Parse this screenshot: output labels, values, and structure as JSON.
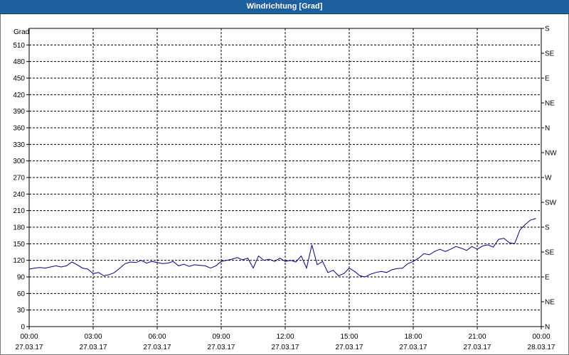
{
  "window": {
    "title": "Windrichtung [Grad]"
  },
  "chart_data": {
    "type": "line",
    "title": "Windrichtung [Grad]",
    "ylabel": "Grad",
    "ylim": [
      0,
      540
    ],
    "yticks": [
      0,
      30,
      60,
      90,
      120,
      150,
      180,
      210,
      240,
      270,
      300,
      330,
      360,
      390,
      420,
      450,
      480,
      510
    ],
    "right_axis_ticks": [
      {
        "value": 0,
        "label": "N"
      },
      {
        "value": 45,
        "label": "NE"
      },
      {
        "value": 90,
        "label": "E"
      },
      {
        "value": 135,
        "label": "SE"
      },
      {
        "value": 180,
        "label": "S"
      },
      {
        "value": 225,
        "label": "SW"
      },
      {
        "value": 270,
        "label": "W"
      },
      {
        "value": 315,
        "label": "NW"
      },
      {
        "value": 360,
        "label": "N"
      },
      {
        "value": 405,
        "label": "NE"
      },
      {
        "value": 450,
        "label": "E"
      },
      {
        "value": 495,
        "label": "SE"
      },
      {
        "value": 540,
        "label": "S"
      }
    ],
    "xlim": [
      "2017-03-27 00:00",
      "2017-03-28 00:00"
    ],
    "xticks": [
      {
        "time": "00:00",
        "date": "27.03.17"
      },
      {
        "time": "03:00",
        "date": "27.03.17"
      },
      {
        "time": "06:00",
        "date": "27.03.17"
      },
      {
        "time": "09:00",
        "date": "27.03.17"
      },
      {
        "time": "12:00",
        "date": "27.03.17"
      },
      {
        "time": "15:00",
        "date": "27.03.17"
      },
      {
        "time": "18:00",
        "date": "27.03.17"
      },
      {
        "time": "21:00",
        "date": "27.03.17"
      },
      {
        "time": "00:00",
        "date": "28.03.17"
      }
    ],
    "grid": true,
    "series": [
      {
        "color": "#00008b",
        "points": [
          [
            "00:00",
            104
          ],
          [
            "00:15",
            106
          ],
          [
            "00:30",
            107
          ],
          [
            "00:45",
            106
          ],
          [
            "01:00",
            108
          ],
          [
            "01:15",
            110
          ],
          [
            "01:30",
            108
          ],
          [
            "01:45",
            110
          ],
          [
            "02:00",
            117
          ],
          [
            "02:15",
            112
          ],
          [
            "02:30",
            106
          ],
          [
            "02:45",
            104
          ],
          [
            "03:00",
            96
          ],
          [
            "03:15",
            98
          ],
          [
            "03:30",
            92
          ],
          [
            "03:45",
            94
          ],
          [
            "04:00",
            98
          ],
          [
            "04:15",
            106
          ],
          [
            "04:30",
            114
          ],
          [
            "04:45",
            117
          ],
          [
            "05:00",
            116
          ],
          [
            "05:15",
            120
          ],
          [
            "05:30",
            115
          ],
          [
            "05:45",
            118
          ],
          [
            "06:00",
            116
          ],
          [
            "06:15",
            114
          ],
          [
            "06:30",
            115
          ],
          [
            "06:45",
            118
          ],
          [
            "07:00",
            110
          ],
          [
            "07:15",
            113
          ],
          [
            "07:30",
            109
          ],
          [
            "07:45",
            112
          ],
          [
            "08:00",
            111
          ],
          [
            "08:15",
            110
          ],
          [
            "08:30",
            106
          ],
          [
            "08:45",
            110
          ],
          [
            "09:00",
            118
          ],
          [
            "09:15",
            120
          ],
          [
            "09:30",
            122
          ],
          [
            "09:45",
            125
          ],
          [
            "10:00",
            121
          ],
          [
            "10:15",
            124
          ],
          [
            "10:30",
            106
          ],
          [
            "10:45",
            128
          ],
          [
            "11:00",
            120
          ],
          [
            "11:15",
            122
          ],
          [
            "11:30",
            118
          ],
          [
            "11:45",
            124
          ],
          [
            "12:00",
            118
          ],
          [
            "12:15",
            120
          ],
          [
            "12:30",
            117
          ],
          [
            "12:45",
            128
          ],
          [
            "13:00",
            106
          ],
          [
            "13:15",
            148
          ],
          [
            "13:30",
            112
          ],
          [
            "13:45",
            118
          ],
          [
            "14:00",
            98
          ],
          [
            "14:15",
            102
          ],
          [
            "14:30",
            92
          ],
          [
            "14:45",
            96
          ],
          [
            "15:00",
            106
          ],
          [
            "15:15",
            100
          ],
          [
            "15:30",
            92
          ],
          [
            "15:45",
            90
          ],
          [
            "16:00",
            95
          ],
          [
            "16:15",
            98
          ],
          [
            "16:30",
            100
          ],
          [
            "16:45",
            98
          ],
          [
            "17:00",
            103
          ],
          [
            "17:15",
            105
          ],
          [
            "17:30",
            106
          ],
          [
            "17:45",
            114
          ],
          [
            "18:00",
            118
          ],
          [
            "18:15",
            124
          ],
          [
            "18:30",
            132
          ],
          [
            "18:45",
            130
          ],
          [
            "19:00",
            136
          ],
          [
            "19:15",
            140
          ],
          [
            "19:30",
            136
          ],
          [
            "19:45",
            140
          ],
          [
            "20:00",
            145
          ],
          [
            "20:15",
            142
          ],
          [
            "20:30",
            138
          ],
          [
            "20:45",
            145
          ],
          [
            "21:00",
            140
          ],
          [
            "21:15",
            146
          ],
          [
            "21:30",
            148
          ],
          [
            "21:45",
            144
          ],
          [
            "22:00",
            158
          ],
          [
            "22:15",
            160
          ],
          [
            "22:30",
            152
          ],
          [
            "22:45",
            150
          ],
          [
            "23:00",
            175
          ],
          [
            "23:15",
            185
          ],
          [
            "23:30",
            193
          ],
          [
            "23:45",
            196
          ]
        ]
      }
    ]
  }
}
